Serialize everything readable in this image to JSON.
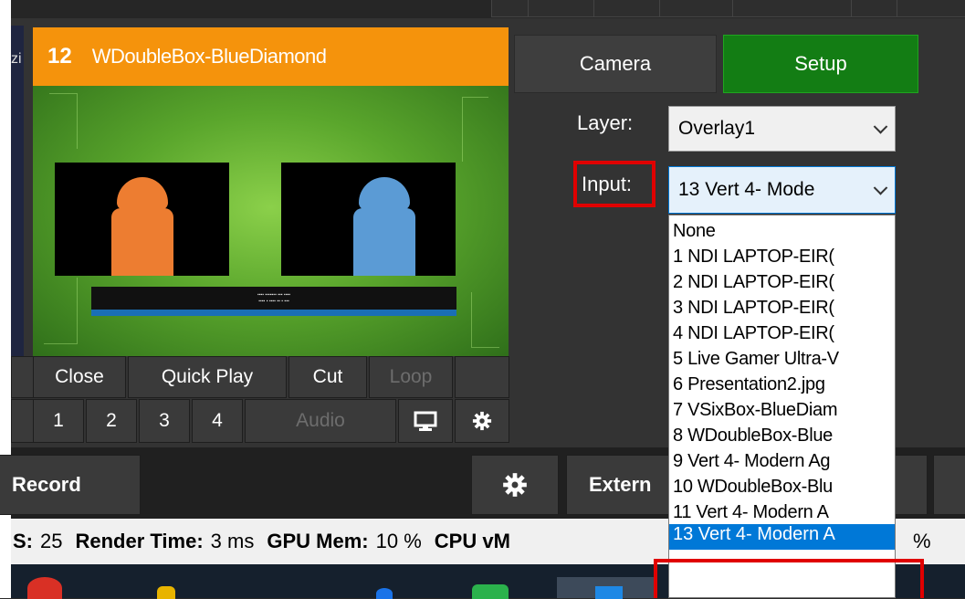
{
  "input_panel": {
    "number": "12",
    "name": "WDoubleBox-BlueDiamond",
    "left_neighbor_fragment": "zi",
    "buttons": {
      "close": "Close",
      "quick_play": "Quick Play",
      "cut": "Cut",
      "loop": "Loop"
    },
    "overlay_numbers": [
      "1",
      "2",
      "3",
      "4"
    ],
    "audio": "Audio"
  },
  "settings": {
    "camera_label": "Camera",
    "setup_label": "Setup",
    "layer_label": "Layer:",
    "layer_value": "Overlay1",
    "input_label": "Input:",
    "input_value": "13 Vert 4- Mode"
  },
  "dropdown": {
    "items": [
      "None",
      "1 NDI LAPTOP-EIR(",
      "2 NDI LAPTOP-EIR(",
      "3 NDI LAPTOP-EIR(",
      "4 NDI LAPTOP-EIR(",
      "5 Live Gamer Ultra-V",
      "6 Presentation2.jpg",
      "7 VSixBox-BlueDiam",
      "8 WDoubleBox-Blue",
      "9 Vert 4- Modern Ag",
      "10 WDoubleBox-Blu",
      "11 Vert 4- Modern A"
    ],
    "selected": "13 Vert 4- Modern A"
  },
  "toolbar": {
    "record": "Record",
    "external": "Extern"
  },
  "status_bar": {
    "fps_label": "S:",
    "fps_value": "25",
    "render_label": "Render Time:",
    "render_value": "3 ms",
    "gpu_label": "GPU Mem:",
    "gpu_value": "10 %",
    "cpu_label": "CPU vM",
    "tail": "%"
  },
  "colors": {
    "title_bar": "#f5930c",
    "setup_button": "#137d14",
    "highlight": "#e00000",
    "selection": "#0078d7"
  }
}
